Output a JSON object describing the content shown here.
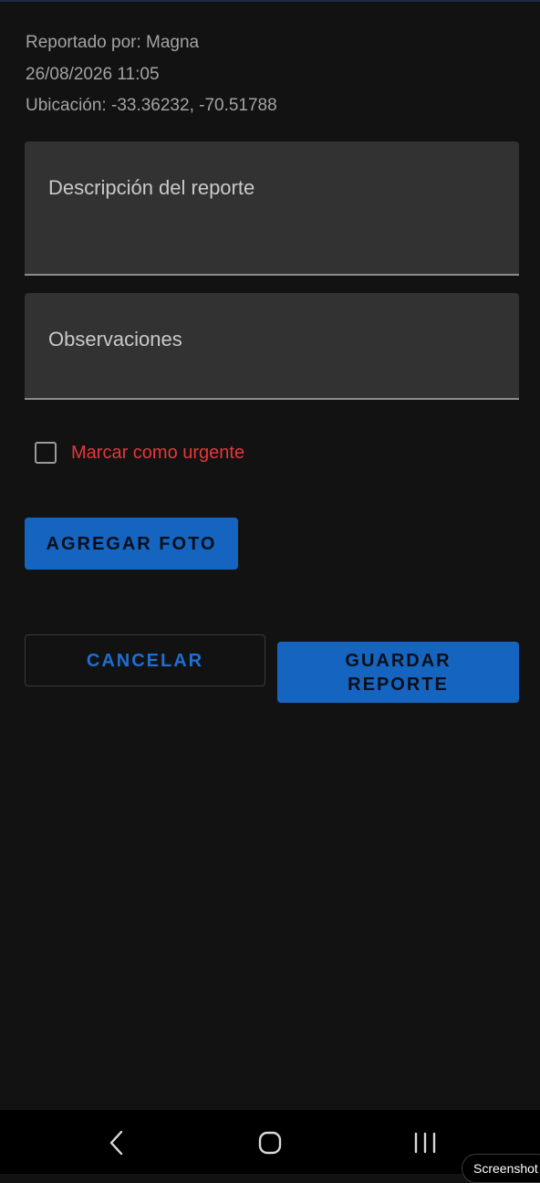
{
  "report": {
    "reporter": "Reportado por: Magna",
    "datetime": "26/08/2026 11:05",
    "location": "Ubicación: -33.36232, -70.51788"
  },
  "form": {
    "description_placeholder": "Descripción del reporte",
    "observations_placeholder": "Observaciones",
    "urgent_label": "Marcar como urgente",
    "urgent_checked": false
  },
  "buttons": {
    "add_photo": "AGREGAR FOTO",
    "cancel": "CANCELAR",
    "save": "GUARDAR REPORTE"
  },
  "system": {
    "screenshot_pill": "Screenshot"
  },
  "colors": {
    "background": "#121212",
    "field_bg": "#323232",
    "primary": "#1565c0",
    "urgent": "#e5373b"
  },
  "icons": {
    "nav_back": "back-icon",
    "nav_home": "home-icon",
    "nav_recents": "recents-icon"
  }
}
